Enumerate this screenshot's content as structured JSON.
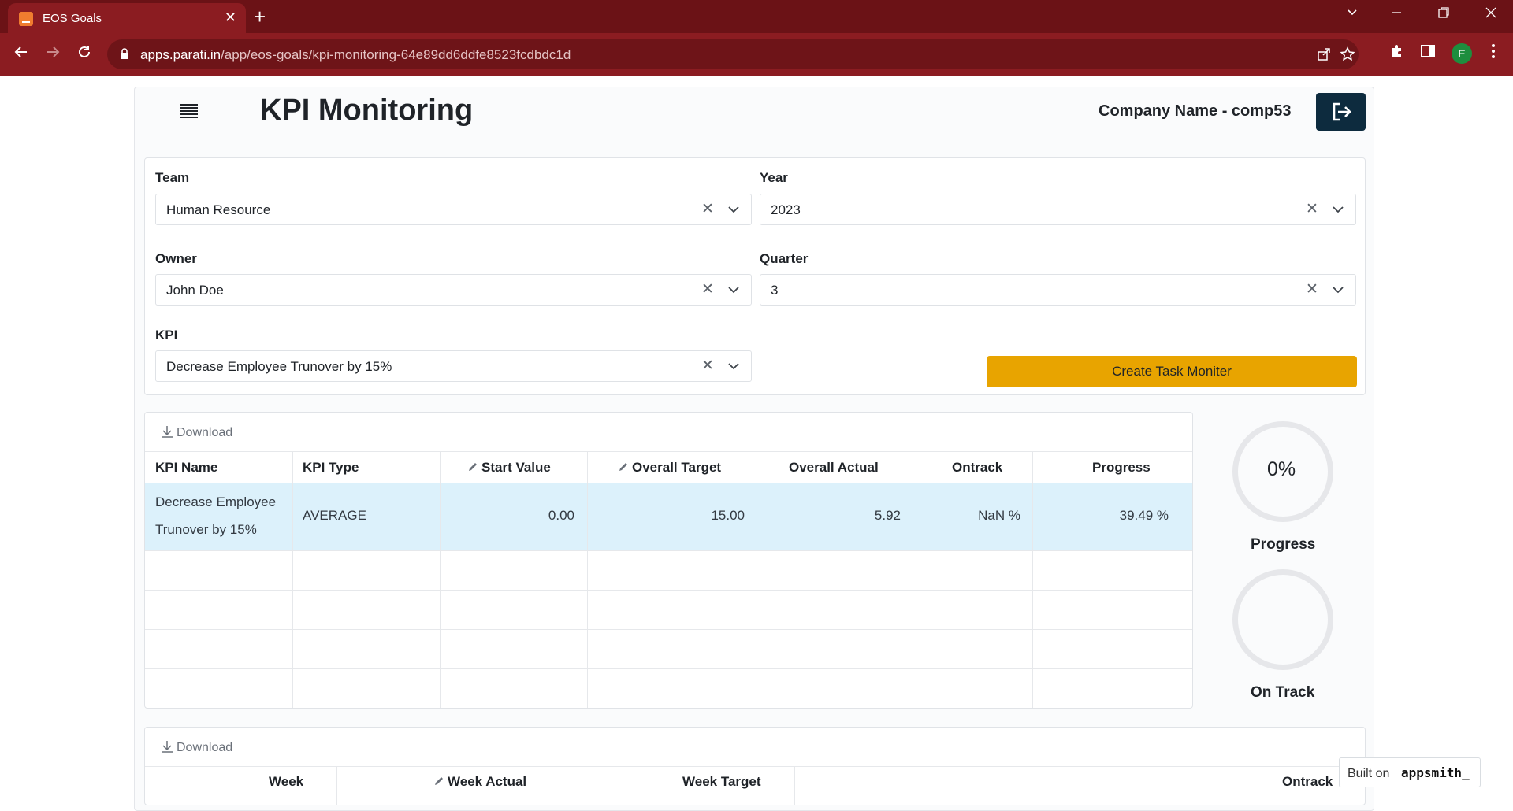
{
  "browser": {
    "tab_title": "EOS Goals",
    "url_host": "apps.parati.in",
    "url_path": "/app/eos-goals/kpi-monitoring-64e89dd6ddfe8523fcdbdc1d",
    "profile_initial": "E"
  },
  "header": {
    "title": "KPI Monitoring",
    "company": "Company Name - comp53"
  },
  "filters": {
    "team": {
      "label": "Team",
      "value": "Human Resource"
    },
    "year": {
      "label": "Year",
      "value": "2023"
    },
    "owner": {
      "label": "Owner",
      "value": "John Doe"
    },
    "quarter": {
      "label": "Quarter",
      "value": "3"
    },
    "kpi": {
      "label": "KPI",
      "value": "Decrease Employee Trunover by 15%"
    },
    "create_button": "Create Task Moniter"
  },
  "kpi_table": {
    "download_label": "Download",
    "columns": [
      "KPI Name",
      "KPI Type",
      "Start Value",
      "Overall Target",
      "Overall Actual",
      "Ontrack",
      "Progress"
    ],
    "rows": [
      {
        "kpi_name_line1": "Decrease Employee",
        "kpi_name_line2": "Trunover by 15%",
        "kpi_type": "AVERAGE",
        "start_value": "0.00",
        "overall_target": "15.00",
        "overall_actual": "5.92",
        "ontrack": "NaN %",
        "progress": "39.49 %"
      }
    ]
  },
  "gauges": {
    "progress": {
      "value": "0%",
      "label": "Progress",
      "percent": 0
    },
    "on_track": {
      "value": "",
      "label": "On Track"
    }
  },
  "week_table": {
    "download_label": "Download",
    "columns": [
      "Week",
      "Week Actual",
      "Week Target",
      "Ontrack"
    ]
  },
  "footer": {
    "built_on": "Built on",
    "brand": "appsmith_"
  },
  "colors": {
    "browser_frame": "#6b1216",
    "toolbar": "#8b1c21",
    "create_button": "#e8a400",
    "logout_button": "#0d2b3e",
    "selected_row": "#dcf1fb"
  }
}
